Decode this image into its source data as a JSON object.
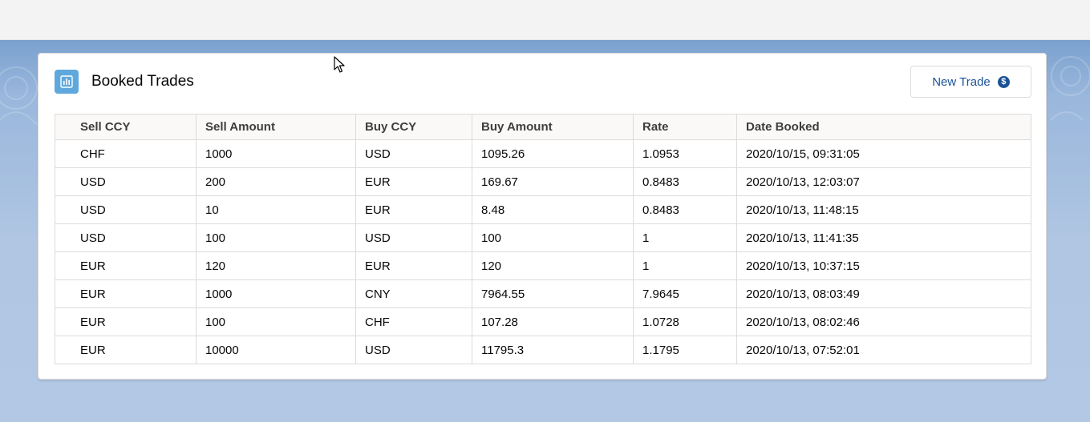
{
  "card": {
    "title": "Booked Trades",
    "new_trade_label": "New Trade",
    "icon": "chart-icon",
    "button_icon": "dollar-circle-icon"
  },
  "table": {
    "columns": [
      "Sell CCY",
      "Sell Amount",
      "Buy CCY",
      "Buy Amount",
      "Rate",
      "Date Booked"
    ],
    "rows": [
      [
        "CHF",
        "1000",
        "USD",
        "1095.26",
        "1.0953",
        "2020/10/15, 09:31:05"
      ],
      [
        "USD",
        "200",
        "EUR",
        "169.67",
        "0.8483",
        "2020/10/13, 12:03:07"
      ],
      [
        "USD",
        "10",
        "EUR",
        "8.48",
        "0.8483",
        "2020/10/13, 11:48:15"
      ],
      [
        "USD",
        "100",
        "USD",
        "100",
        "1",
        "2020/10/13, 11:41:35"
      ],
      [
        "EUR",
        "120",
        "EUR",
        "120",
        "1",
        "2020/10/13, 10:37:15"
      ],
      [
        "EUR",
        "1000",
        "CNY",
        "7964.55",
        "7.9645",
        "2020/10/13, 08:03:49"
      ],
      [
        "EUR",
        "100",
        "CHF",
        "107.28",
        "1.0728",
        "2020/10/13, 08:02:46"
      ],
      [
        "EUR",
        "10000",
        "USD",
        "11795.3",
        "1.1795",
        "2020/10/13, 07:52:01"
      ]
    ]
  },
  "colors": {
    "header_icon_bg": "#5fa8dd",
    "button_text": "#1b5297",
    "background": "#b0c6e3"
  }
}
